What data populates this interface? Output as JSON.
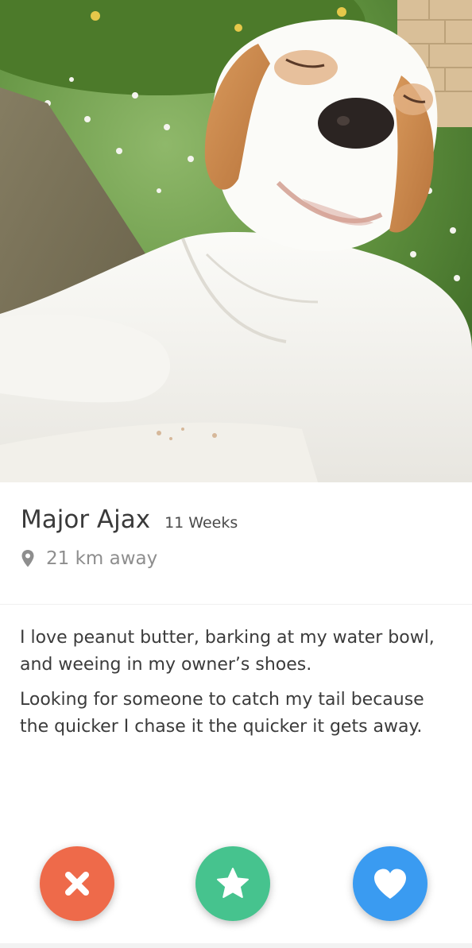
{
  "profile": {
    "name": "Major Ajax",
    "age": "11 Weeks",
    "distance": "21 km away",
    "photo_icon": "dog-photo"
  },
  "bio": {
    "paragraph_1": "I love peanut butter, barking at my water bowl, and weeing in my owner’s shoes.",
    "paragraph_2": "Looking for someone to catch my tail because the quicker I chase it the quicker it gets away."
  },
  "actions": {
    "nope": {
      "icon": "close-icon",
      "color": "#ee6a4a"
    },
    "super_like": {
      "icon": "star-icon",
      "color": "#46c38e"
    },
    "like": {
      "icon": "heart-icon",
      "color": "#3a9bf1"
    }
  },
  "colors": {
    "name_text": "#3a3a3a",
    "distance_text": "#8e8e8e",
    "bio_text": "#3b3b3b"
  }
}
